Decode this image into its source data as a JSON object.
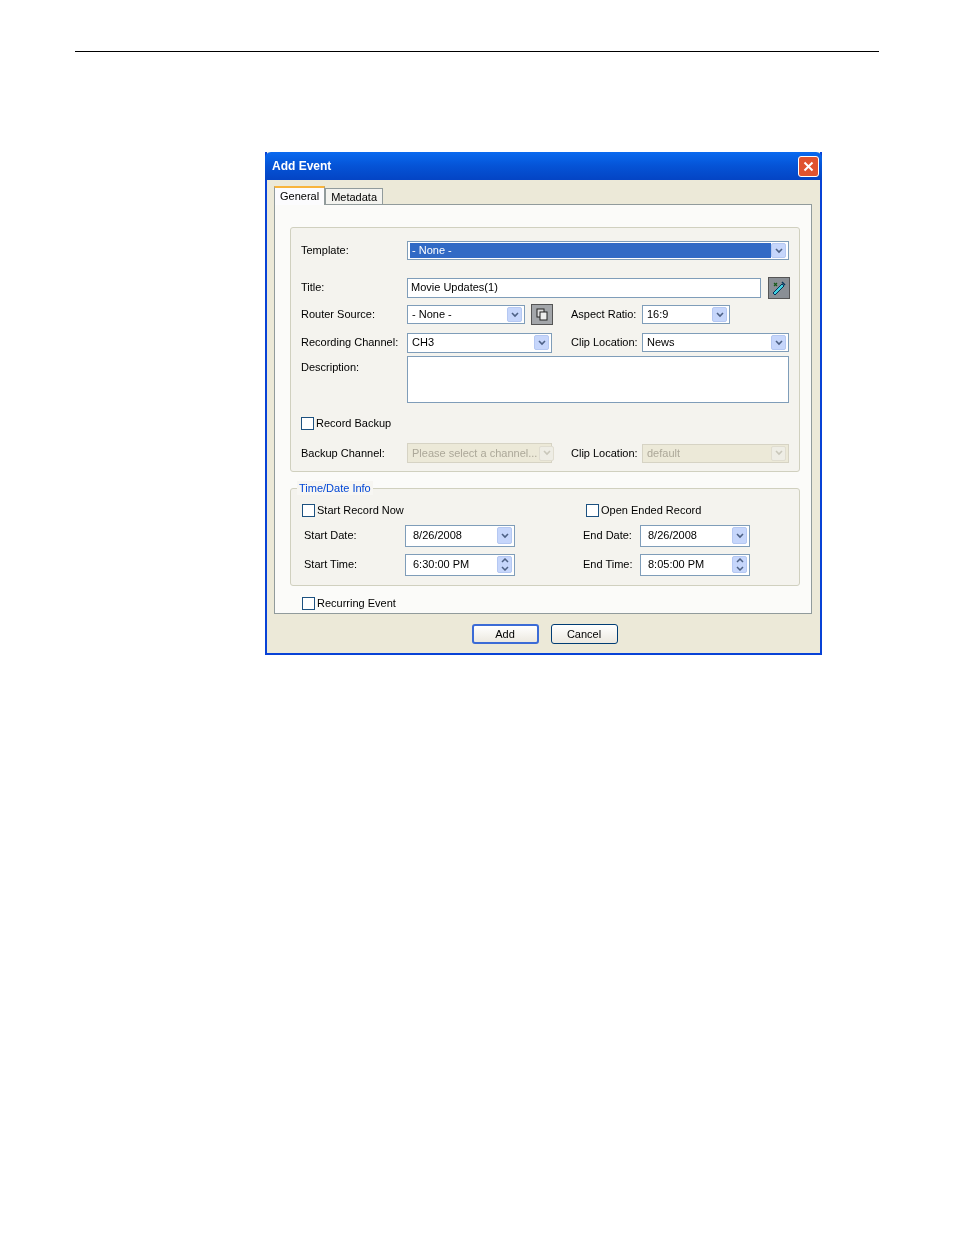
{
  "window": {
    "title": "Add Event"
  },
  "tabs": [
    {
      "label": "General",
      "selected": true
    },
    {
      "label": "Metadata",
      "selected": false
    }
  ],
  "template": {
    "label": "Template:",
    "value": "- None -",
    "highlighted": true
  },
  "title": {
    "label": "Title:",
    "value": "Movie Updates(1)"
  },
  "router_source": {
    "label": "Router Source:",
    "value": "- None -"
  },
  "aspect_ratio": {
    "label": "Aspect Ratio:",
    "value": "16:9"
  },
  "recording_channel": {
    "label": "Recording Channel:",
    "value": "CH3"
  },
  "clip_location": {
    "label": "Clip Location:",
    "value": "News",
    "disabled": false
  },
  "description": {
    "label": "Description:"
  },
  "record_backup": {
    "label": "Record Backup",
    "checked": false
  },
  "backup_channel": {
    "label": "Backup Channel:",
    "value": "Please select a channel...",
    "disabled": true
  },
  "backup_clip_location": {
    "label": "Clip Location:",
    "value": "default",
    "disabled": true
  },
  "time_date_info": {
    "legend": "Time/Date Info",
    "start_record_now": {
      "label": "Start Record Now",
      "checked": false
    },
    "open_ended_record": {
      "label": "Open Ended Record",
      "checked": false
    },
    "start_date": {
      "label": "Start Date:",
      "value": "8/26/2008"
    },
    "end_date": {
      "label": "End Date:",
      "value": "8/26/2008"
    },
    "start_time": {
      "label": "Start Time:",
      "value": "6:30:00 PM"
    },
    "end_time": {
      "label": "End Time:",
      "value": "8:05:00 PM"
    }
  },
  "recurring_event": {
    "label": "Recurring Event",
    "checked": false
  },
  "buttons": [
    {
      "label": "Add",
      "default": true
    },
    {
      "label": "Cancel",
      "default": false
    }
  ]
}
